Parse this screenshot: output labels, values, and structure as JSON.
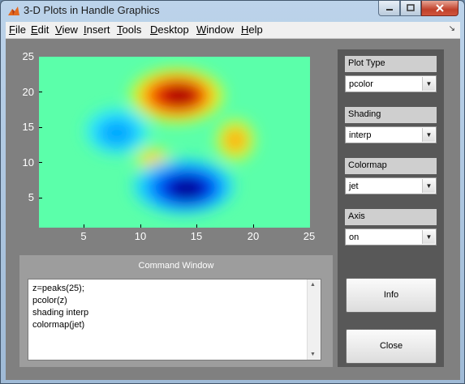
{
  "window": {
    "title": "3-D Plots in Handle Graphics"
  },
  "menubar": {
    "items": [
      {
        "label": "File",
        "underline": "F",
        "rest": "ile"
      },
      {
        "label": "Edit",
        "underline": "E",
        "rest": "dit"
      },
      {
        "label": "View",
        "underline": "V",
        "rest": "iew"
      },
      {
        "label": "Insert",
        "underline": "I",
        "rest": "nsert"
      },
      {
        "label": "Tools",
        "underline": "T",
        "rest": "ools"
      },
      {
        "label": "Desktop",
        "underline": "D",
        "rest": "esktop"
      },
      {
        "label": "Window",
        "underline": "W",
        "rest": "indow"
      },
      {
        "label": "Help",
        "underline": "H",
        "rest": "elp"
      }
    ],
    "dock_icon": "dock-arrow-icon"
  },
  "plot": {
    "yticks": [
      "25",
      "20",
      "15",
      "10",
      "5"
    ],
    "xticks": [
      "5",
      "10",
      "15",
      "20",
      "25"
    ],
    "colormap": "jet",
    "background_color": "#5bffaa"
  },
  "command_window": {
    "title": "Command Window",
    "lines": [
      "z=peaks(25);",
      "pcolor(z)",
      "shading interp",
      "colormap(jet)"
    ]
  },
  "controls": {
    "plot_type": {
      "label": "Plot Type",
      "value": "pcolor"
    },
    "shading": {
      "label": "Shading",
      "value": "interp"
    },
    "colormap": {
      "label": "Colormap",
      "value": "jet"
    },
    "axis": {
      "label": "Axis",
      "value": "on"
    },
    "info_button": "Info",
    "close_button": "Close"
  }
}
